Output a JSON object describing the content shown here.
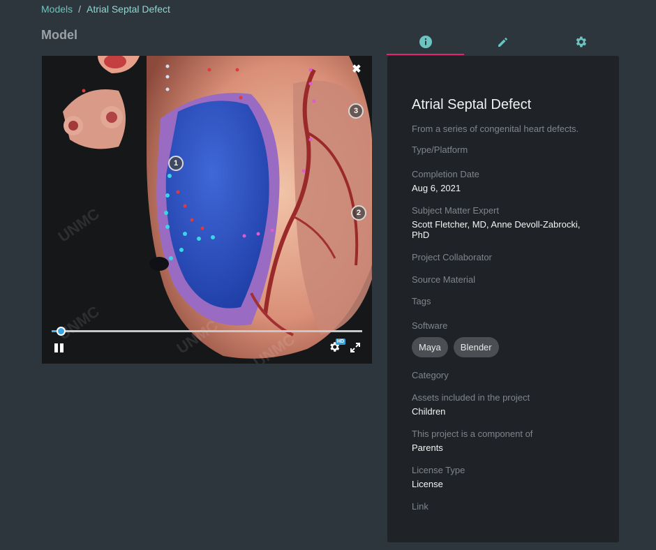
{
  "breadcrumb": {
    "parent": "Models",
    "separator": "/",
    "current": "Atrial Septal Defect"
  },
  "section_title": "Model",
  "viewer": {
    "watermark": "UNMC",
    "hotspots": [
      "1",
      "2",
      "3"
    ],
    "hd_badge": "HD",
    "close_icon": "close-icon",
    "progress": 0.03
  },
  "tabs": [
    {
      "icon": "info-icon",
      "active": true
    },
    {
      "icon": "pencil-icon",
      "active": false
    },
    {
      "icon": "gear-icon",
      "active": false
    }
  ],
  "colors": {
    "accent": "#6cc4c0",
    "tab_indicator": "#e2266b",
    "panel_bg": "#1f2226",
    "page_bg": "#2e363d"
  },
  "panel": {
    "title": "Atrial Septal Defect",
    "description": "From a series of congenital heart defects.",
    "type_label": "Type/Platform",
    "completion_label": "Completion Date",
    "completion_value": "Aug 6, 2021",
    "sme_label": "Subject Matter Expert",
    "sme_value": "Scott Fletcher, MD, Anne Devoll-Zabrocki, PhD",
    "collaborator_label": "Project Collaborator",
    "source_label": "Source Material",
    "tags_label": "Tags",
    "software_label": "Software",
    "software": [
      "Maya",
      "Blender"
    ],
    "category_label": "Category",
    "assets_label": "Assets included in the project",
    "assets_value": "Children",
    "component_label": "This project is a component of",
    "component_value": "Parents",
    "license_label": "License Type",
    "license_value": "License",
    "link_label": "Link"
  }
}
